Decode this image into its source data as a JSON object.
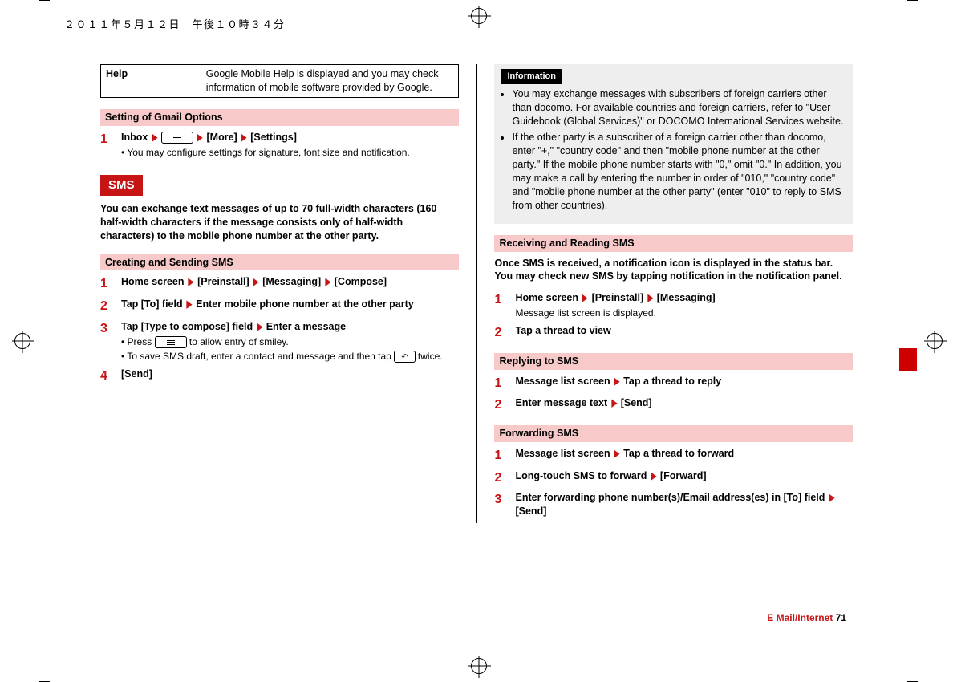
{
  "page_date": "２０１１年５月１２日　午後１０時３４分",
  "help_table": {
    "label": "Help",
    "text": "Google Mobile Help is displayed and you may check information of mobile software provided by Google."
  },
  "sections": {
    "gmail_options": {
      "title": "Setting of Gmail Options",
      "steps": [
        {
          "num": "1",
          "main_parts": [
            "Inbox ",
            "▶",
            " ",
            "[key-lines]",
            " ",
            "▶",
            " [More] ",
            "▶",
            " [Settings]"
          ],
          "sub": "• You may configure settings for signature, font size and notification."
        }
      ]
    },
    "sms": {
      "title": "SMS",
      "intro": "You can exchange text messages of up to 70 full-width characters (160 half-width characters if the message consists only of half-width characters) to the mobile phone number at the other party."
    },
    "creating_sending": {
      "title": "Creating and Sending SMS",
      "steps": [
        {
          "num": "1",
          "text": "Home screen ▶ [Preinstall] ▶ [Messaging] ▶ [Compose]"
        },
        {
          "num": "2",
          "text": "Tap [To] field ▶ Enter mobile phone number at the other party"
        },
        {
          "num": "3",
          "text": "Tap [Type to compose] field ▶ Enter a message",
          "subs": [
            "• Press [key-lines] to allow entry of smiley.",
            "• To save SMS draft, enter a contact and message and then tap [key-back] twice."
          ]
        },
        {
          "num": "4",
          "text": "[Send]"
        }
      ]
    },
    "information": {
      "label": "Information",
      "items": [
        "You may exchange messages with subscribers of foreign carriers other than docomo. For available countries and foreign carriers, refer to \"User Guidebook (Global Services)\" or DOCOMO International Services website.",
        "If the other party is a subscriber of a foreign carrier other than docomo, enter \"+,\" \"country code\" and then \"mobile phone number at the other party.\" If the mobile phone number starts with \"0,\" omit \"0.\" In addition, you may make a call by entering the number in order of \"010,\" \"country code\" and \"mobile phone number at the other party\" (enter \"010\" to reply to SMS from other countries)."
      ]
    },
    "receiving_reading": {
      "title": "Receiving and Reading SMS",
      "intro": "Once SMS is received, a notification icon is displayed in the status bar. You may check new SMS by tapping notification in the notification panel.",
      "steps": [
        {
          "num": "1",
          "text": "Home screen ▶ [Preinstall] ▶ [Messaging]",
          "sub": "Message list screen is displayed."
        },
        {
          "num": "2",
          "text": "Tap a thread to view"
        }
      ]
    },
    "replying": {
      "title": "Replying to SMS",
      "steps": [
        {
          "num": "1",
          "text": "Message list screen ▶ Tap a thread to reply"
        },
        {
          "num": "2",
          "text": "Enter message text ▶ [Send]"
        }
      ]
    },
    "forwarding": {
      "title": "Forwarding SMS",
      "steps": [
        {
          "num": "1",
          "text": "Message list screen ▶ Tap a thread to forward"
        },
        {
          "num": "2",
          "text": "Long-touch SMS to forward ▶ [Forward]"
        },
        {
          "num": "3",
          "text": "Enter forwarding phone number(s)/Email address(es) in [To] field ▶ [Send]"
        }
      ]
    }
  },
  "footer": {
    "title": "E Mail/Internet",
    "page": "71"
  }
}
